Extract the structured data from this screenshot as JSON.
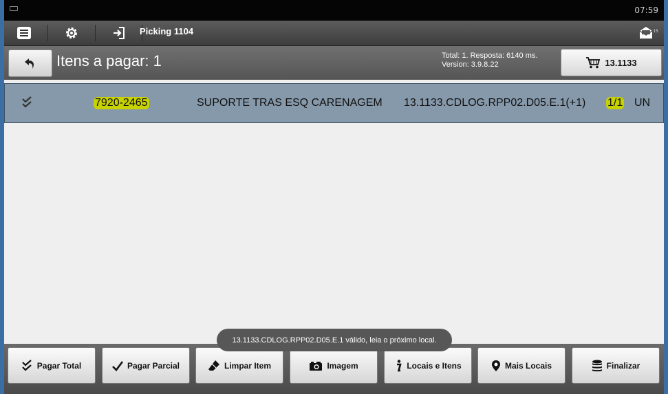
{
  "status_bar": {
    "time": "07:59"
  },
  "top_bar": {
    "title": "Picking 1104",
    "icons": [
      "menu-icon",
      "settings-gear-icon",
      "login-icon",
      "envelope-icon"
    ],
    "message_count": "15"
  },
  "header": {
    "title": "Itens a pagar: 1",
    "info_line1": "Total: 1. Resposta: 6140 ms.",
    "info_line2": "Version: 3.9.8.22",
    "cart_label": "13.1133"
  },
  "items": [
    {
      "code": "7920-2465",
      "description": "SUPORTE TRAS ESQ CARENAGEM",
      "location": "13.1133.CDLOG.RPP02.D05.E.1(+1)",
      "quantity": "1/1",
      "unit": "UN"
    }
  ],
  "toast": "13.1133.CDLOG.RPP02.D05.E.1 válido, leia o próximo local.",
  "bottom_buttons": {
    "pagar_total": "Pagar Total",
    "pagar_parcial": "Pagar Parcial",
    "limpar_item": "Limpar Item",
    "imagem": "Imagem",
    "locais_itens": "Locais e Itens",
    "mais_locais": "Mais Locais",
    "finalizar": "Finalizar"
  },
  "colors": {
    "selected_row": "#8699ab",
    "highlight": "#c7d200",
    "toolbar": "#4a4a4a"
  }
}
